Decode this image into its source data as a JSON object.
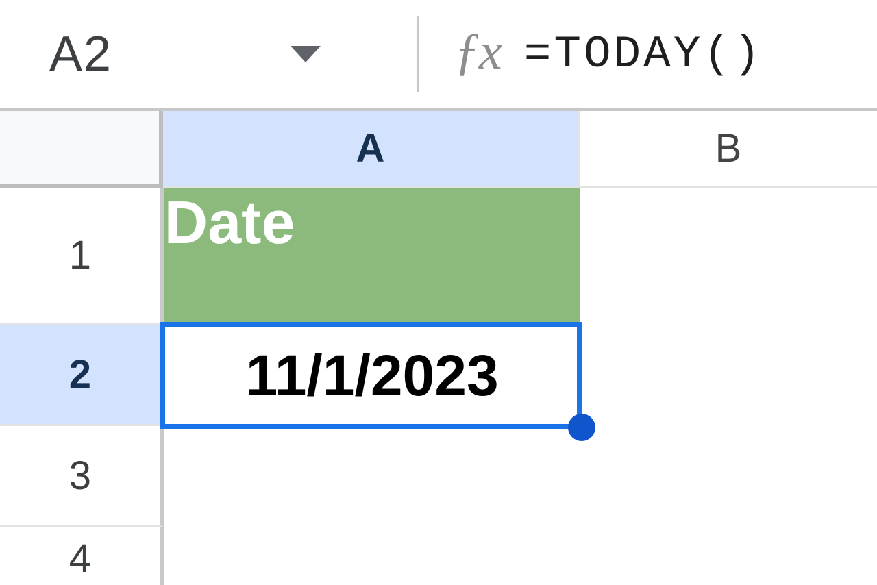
{
  "formula_bar": {
    "cell_ref": "A2",
    "formula": "=TODAY()"
  },
  "columns": {
    "A": "A",
    "B": "B"
  },
  "rows": {
    "r1": {
      "num": "1",
      "A": "Date",
      "B": ""
    },
    "r2": {
      "num": "2",
      "A": "11/1/2023",
      "B": ""
    },
    "r3": {
      "num": "3",
      "A": "",
      "B": ""
    },
    "r4": {
      "num": "4",
      "A": "",
      "B": ""
    }
  },
  "selection": {
    "cell": "A2"
  }
}
